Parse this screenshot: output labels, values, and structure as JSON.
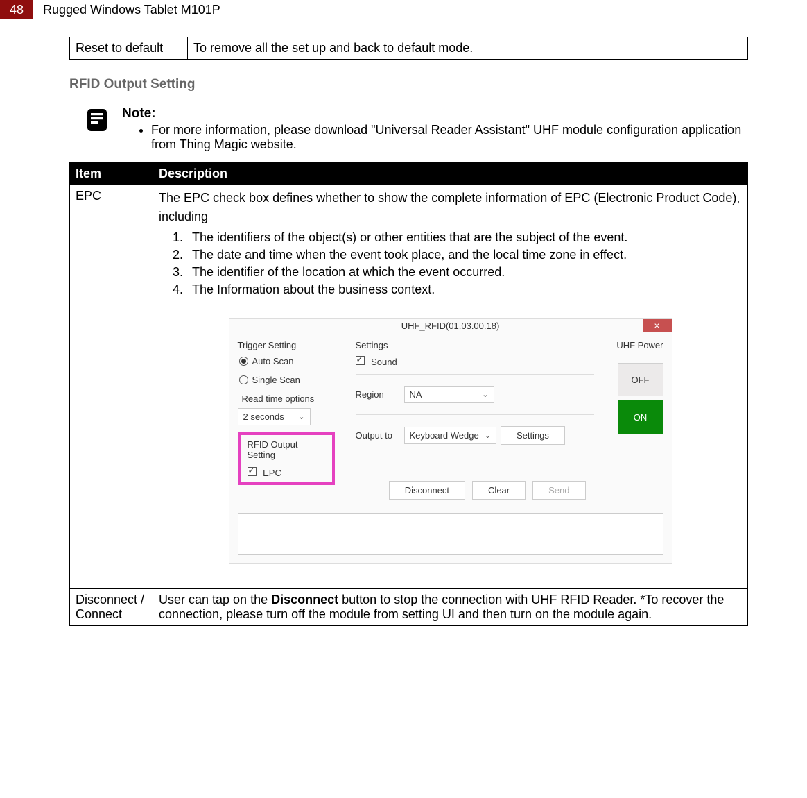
{
  "page": {
    "number": "48",
    "title": "Rugged Windows Tablet M101P"
  },
  "reset_table": {
    "label": "Reset to default",
    "desc": "To remove all the set up and back to default mode."
  },
  "section_heading": "RFID Output Setting",
  "note": {
    "title": "Note:",
    "bullet": "For more information, please download \"Universal Reader Assistant\" UHF module configuration application from Thing Magic website."
  },
  "desc_table": {
    "headers": {
      "item": "Item",
      "desc": "Description"
    },
    "rows": [
      {
        "item": "EPC",
        "desc_intro": "The EPC check box defines whether to show the complete information of EPC (Electronic Product Code), including",
        "ol": [
          "The identifiers of the object(s) or other entities that are the subject of the event.",
          "The date and time when the event took place, and the local time zone in effect.",
          "The identifier of the location at which the event occurred.",
          "The Information about the business context."
        ]
      },
      {
        "item": "Disconnect / Connect",
        "desc_parts": {
          "pre": "User can tap on the ",
          "bold": "Disconnect",
          "post": " button to stop the connection with UHF RFID Reader. *To recover the connection, please turn off the module from setting UI and then turn on the module again."
        }
      }
    ]
  },
  "app": {
    "title": "UHF_RFID(01.03.00.18)",
    "trigger_label": "Trigger Setting",
    "auto_scan": "Auto Scan",
    "single_scan": "Single Scan",
    "read_time_label": "Read time options",
    "read_time_value": "2 seconds",
    "settings_label": "Settings",
    "sound_label": "Sound",
    "region_label": "Region",
    "region_value": "NA",
    "output_label": "Output to",
    "output_value": "Keyboard Wedge",
    "settings_btn": "Settings",
    "rfid_out_label": "RFID Output Setting",
    "epc_label": "EPC",
    "uhf_power_label": "UHF Power",
    "off": "OFF",
    "on": "ON",
    "disconnect": "Disconnect",
    "clear": "Clear",
    "send": "Send"
  }
}
